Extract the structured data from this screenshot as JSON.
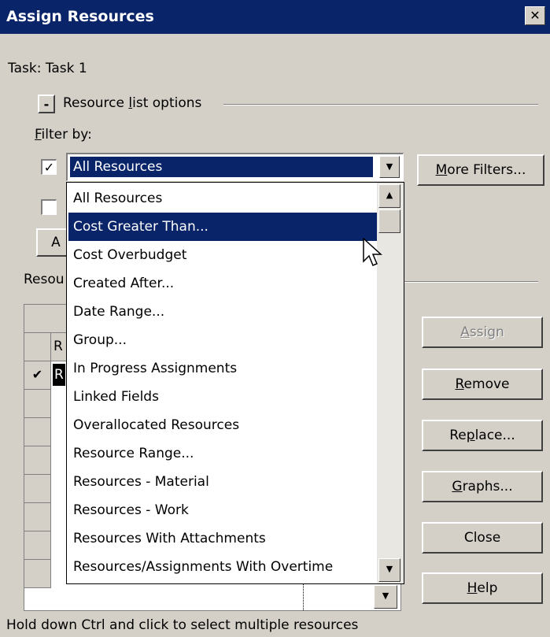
{
  "dialog": {
    "title": "Assign Resources",
    "task_label": "Task: Task 1",
    "options_toggle": "-",
    "options_label": "Resource list options",
    "filter_by_label": "Filter by:",
    "filter_checked_mark": "✓",
    "filter_selected": "All Resources",
    "more_filters_label": "More Filters...",
    "resources_label_fragment": "Resou",
    "status_text": "Hold down Ctrl and click to select multiple resources"
  },
  "buttons": {
    "assign": "Assign",
    "remove": "Remove",
    "replace": "Replace...",
    "graphs": "Graphs...",
    "close": "Close",
    "help": "Help"
  },
  "dropdown": {
    "items": [
      "All Resources",
      "Cost Greater Than...",
      "Cost Overbudget",
      "Created After...",
      "Date Range...",
      "Group...",
      "In Progress Assignments",
      "Linked Fields",
      "Overallocated Resources",
      "Resource Range...",
      "Resources - Material",
      "Resources - Work",
      "Resources With Attachments",
      "Resources/Assignments With Overtime"
    ],
    "highlighted": "Cost Greater Than..."
  },
  "grid": {
    "col_fragment": "R",
    "row1_check": "✔",
    "row1_fragment": "R"
  },
  "colors": {
    "title_bar": "#0a246a",
    "dialog_face": "#d4d0c8",
    "selection": "#0a246a"
  }
}
